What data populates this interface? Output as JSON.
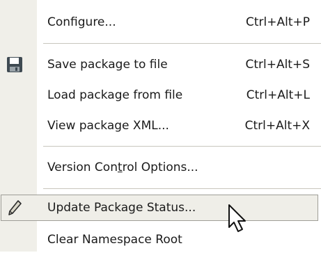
{
  "menu": {
    "configure": {
      "label": "Configure...",
      "shortcut": "Ctrl+Alt+P"
    },
    "save_package": {
      "label": "Save package to file",
      "shortcut": "Ctrl+Alt+S",
      "icon": "floppy-disk-icon"
    },
    "load_package": {
      "label": "Load package from file",
      "shortcut": "Ctrl+Alt+L"
    },
    "view_xml": {
      "label": "View package XML...",
      "shortcut": "Ctrl+Alt+X"
    },
    "version_control": {
      "label_before": "Version Con",
      "label_underlined": "t",
      "label_after": "rol Options..."
    },
    "update_status": {
      "label": "Update Package Status...",
      "icon": "pencil-icon"
    },
    "clear_namespace": {
      "label": "Clear Namespace Root"
    }
  },
  "colors": {
    "gutter": "#f0efe9",
    "highlight_fill": "#efeee8",
    "highlight_border": "#9e9d97",
    "separator": "#c8c6bd"
  }
}
